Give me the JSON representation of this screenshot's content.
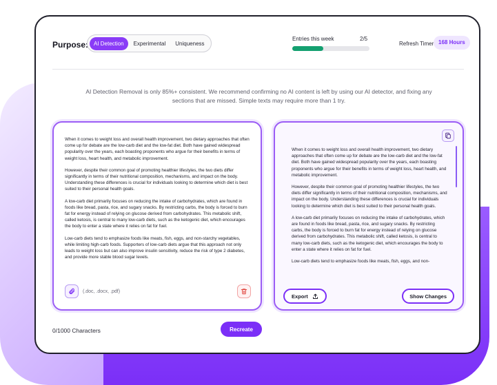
{
  "header": {
    "purpose_label": "Purpose:",
    "modes": [
      {
        "label": "AI Detection",
        "active": true
      },
      {
        "label": "Experimental",
        "active": false
      },
      {
        "label": "Uniqueness",
        "active": false
      }
    ],
    "entries_label": "Entries this week",
    "entries_count": "2/5",
    "entries_progress_percent": 40,
    "refresh_label": "Refresh Timer",
    "refresh_value": "168 Hours"
  },
  "notice": "AI Detection Removal is only 85%+ consistent. We recommend confirming no AI content is left by using our AI detector, and fixing any sections  that are missed. Simple texts may require more than 1 try.",
  "input_panel": {
    "paragraphs": [
      "When it comes to weight loss and overall health improvement, two dietary approaches that often come up for debate are the low-carb diet and the low-fat diet. Both have gained widespread popularity over the years, each boasting proponents who argue for their benefits in terms of weight loss, heart health, and metabolic improvement.",
      "However, despite their common goal of promoting healthier lifestyles, the two diets differ significantly in terms of their nutritional composition, mechanisms, and impact on the body. Understanding these differences is crucial for individuals looking to determine which diet is best suited to their personal health goals.",
      "A low-carb diet primarily focuses on reducing the intake of carbohydrates, which are found in foods like bread, pasta, rice, and sugary snacks. By restricting carbs, the body is forced to burn fat for energy instead of relying on glucose derived from carbohydrates. This metabolic shift, called ketosis, is central to many low-carb diets, such as the ketogenic diet, which encourages the body to enter a state where it relies on fat for fuel.",
      "Low-carb diets tend to emphasize foods like meats, fish, eggs, and non-starchy vegetables, while limiting high-carb foods. Supporters of low-carb diets argue that this approach not only leads to weight loss but can also improve insulin sensitivity, reduce the risk of type 2 diabetes, and provide more stable blood sugar levels."
    ],
    "file_types": "(.doc, .docx, .pdf)"
  },
  "output_panel": {
    "paragraphs": [
      "When it comes to weight loss and overall health improvement, two dietary approaches that often come up for debate are the low-carb diet and the low-fat diet. Both have gained widespread popularity over the years, each boasting proponents who argue for their benefits in terms of weight loss, heart health, and metabolic improvement.",
      "However, despite their common goal of promoting healthier lifestyles, the two diets differ significantly in terms of their nutritional composition, mechanisms, and impact on the body. Understanding these differences is crucial for individuals looking to determine which diet is best suited to their personal health goals.",
      "A low-carb diet primarily focuses on reducing the intake of carbohydrates, which are found in foods like bread, pasta, rice, and sugary snacks. By restricting carbs, the body is forced to burn fat for energy instead of relying on glucose derived from carbohydrates. This metabolic shift, called ketosis, is central to many low-carb diets, such as the ketogenic diet, which encourages the body to enter a state where it relies on fat for fuel.",
      "Low-carb diets tend to emphasize foods like meats, fish, eggs, and non-"
    ],
    "export_label": "Export",
    "show_changes_label": "Show Changes"
  },
  "footer": {
    "char_count": "0/1000 Characters",
    "recreate_label": "Recreate"
  },
  "icons": {
    "attach": "paperclip-icon",
    "delete": "trash-icon",
    "copy": "copy-icon",
    "export": "upload-icon"
  },
  "colors": {
    "accent": "#7b2ff7",
    "progress": "#14a070",
    "delete": "#e0453e"
  }
}
